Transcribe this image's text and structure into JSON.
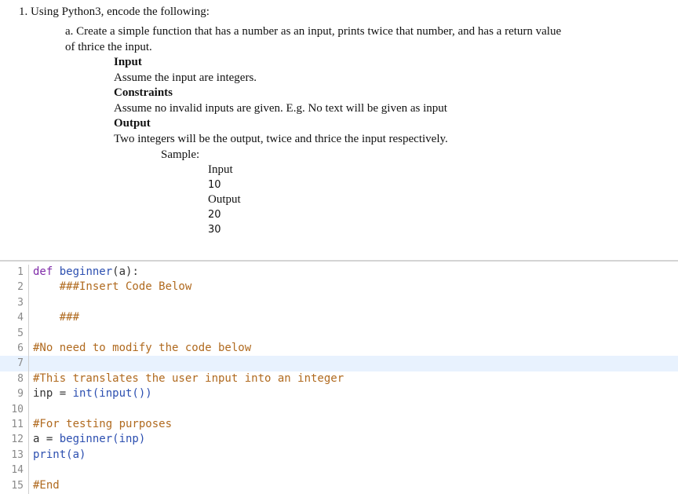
{
  "problem": {
    "line1": "1. Using Python3, encode the following:",
    "line2": "a. Create a simple function that has a number as an input, prints twice that number, and has a return value",
    "line3": "of thrice the input.",
    "input_heading": "Input",
    "input_text": "Assume the input are integers.",
    "constraints_heading": "Constraints",
    "constraints_text": "Assume no invalid inputs are given. E.g. No text will be given as input",
    "output_heading": "Output",
    "output_text": "Two integers will be the output, twice and thrice the input respectively.",
    "sample_label": "Sample:",
    "sample_input_label": "Input",
    "sample_input_value": "10",
    "sample_output_label": "Output",
    "sample_output_value_1": "20",
    "sample_output_value_2": "30"
  },
  "editor": {
    "line_numbers": [
      "1",
      "2",
      "3",
      "4",
      "5",
      "6",
      "7",
      "8",
      "9",
      "10",
      "11",
      "12",
      "13",
      "14",
      "15"
    ],
    "highlighted_line": 7,
    "code": {
      "l1_kw": "def",
      "l1_fn": "beginner",
      "l1_rest": "(a):",
      "l2": "###Insert Code Below",
      "l4": "###",
      "l6": "#No need to modify the code below",
      "l8": "#This translates the user input into an integer",
      "l9_var": "inp = ",
      "l9_fn": "int(input())",
      "l11": "#For testing purposes",
      "l12_var": "a = ",
      "l12_fn": "beginner(inp)",
      "l13_fn": "print(a)",
      "l15": "#End"
    },
    "colors": {
      "keyword": "#7f2aa8",
      "function": "#2c4fb0",
      "comment": "#b06a1f",
      "line_highlight": "#e8f2fe"
    }
  }
}
